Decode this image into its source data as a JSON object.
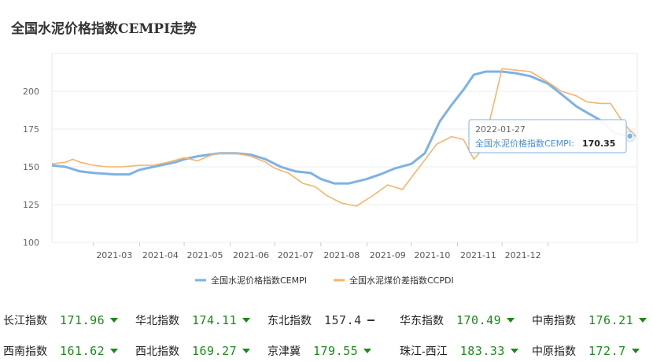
{
  "title": "全国水泥价格指数CEMPI走势",
  "colors": {
    "cempi": "#7eb2e4",
    "ccpdi": "#f5b56c",
    "down": "#1a8a1a",
    "flat": "#333333"
  },
  "chart_data": {
    "type": "line",
    "title": "全国水泥价格指数CEMPI走势",
    "xlabel": "",
    "ylabel": "",
    "ylim": [
      100,
      225
    ],
    "yticks": [
      100,
      125,
      150,
      175,
      200
    ],
    "xticks": [
      "2021-03",
      "2021-04",
      "2021-05",
      "2021-06",
      "2021-07",
      "2021-08",
      "2021-09",
      "2021-10",
      "2021-11",
      "2021-12"
    ],
    "grid": "horizontal",
    "legend": "bottom",
    "series": [
      {
        "name": "全国水泥价格指数CEMPI",
        "color": "#7eb2e4",
        "points": [
          [
            "2021-02-01",
            151
          ],
          [
            "2021-02-10",
            150
          ],
          [
            "2021-02-20",
            147
          ],
          [
            "2021-03-01",
            146
          ],
          [
            "2021-03-15",
            145
          ],
          [
            "2021-03-25",
            145
          ],
          [
            "2021-04-01",
            148
          ],
          [
            "2021-04-15",
            151
          ],
          [
            "2021-04-25",
            153
          ],
          [
            "2021-05-01",
            155
          ],
          [
            "2021-05-10",
            157
          ],
          [
            "2021-05-25",
            159
          ],
          [
            "2021-06-05",
            159
          ],
          [
            "2021-06-15",
            158
          ],
          [
            "2021-06-25",
            155
          ],
          [
            "2021-07-05",
            150
          ],
          [
            "2021-07-15",
            147
          ],
          [
            "2021-07-25",
            146
          ],
          [
            "2021-08-01",
            142
          ],
          [
            "2021-08-10",
            139
          ],
          [
            "2021-08-20",
            139
          ],
          [
            "2021-09-01",
            142
          ],
          [
            "2021-09-10",
            145
          ],
          [
            "2021-09-20",
            149
          ],
          [
            "2021-10-01",
            152
          ],
          [
            "2021-10-10",
            159
          ],
          [
            "2021-10-20",
            180
          ],
          [
            "2021-10-28",
            191
          ],
          [
            "2021-11-05",
            201
          ],
          [
            "2021-11-12",
            211
          ],
          [
            "2021-11-20",
            213
          ],
          [
            "2021-12-01",
            213
          ],
          [
            "2021-12-10",
            212
          ],
          [
            "2021-12-20",
            210
          ],
          [
            "2022-01-01",
            205
          ],
          [
            "2022-01-10",
            198
          ],
          [
            "2022-01-20",
            190
          ],
          [
            "2022-01-27",
            186
          ],
          [
            "2022-02-05",
            181
          ],
          [
            "2022-02-15",
            172
          ],
          [
            "2022-02-25",
            170.35
          ]
        ]
      },
      {
        "name": "全国水泥煤价差指数CCPDI",
        "color": "#f5b56c",
        "points": [
          [
            "2021-02-01",
            152
          ],
          [
            "2021-02-10",
            153
          ],
          [
            "2021-02-15",
            155
          ],
          [
            "2021-02-20",
            153
          ],
          [
            "2021-03-01",
            151
          ],
          [
            "2021-03-10",
            150
          ],
          [
            "2021-03-20",
            150
          ],
          [
            "2021-04-01",
            151
          ],
          [
            "2021-04-10",
            151
          ],
          [
            "2021-04-20",
            153
          ],
          [
            "2021-05-01",
            156
          ],
          [
            "2021-05-10",
            154
          ],
          [
            "2021-05-20",
            158
          ],
          [
            "2021-05-25",
            159
          ],
          [
            "2021-06-05",
            159
          ],
          [
            "2021-06-15",
            157
          ],
          [
            "2021-06-25",
            153
          ],
          [
            "2021-07-01",
            149
          ],
          [
            "2021-07-10",
            146
          ],
          [
            "2021-07-20",
            139
          ],
          [
            "2021-07-28",
            137
          ],
          [
            "2021-08-05",
            131
          ],
          [
            "2021-08-15",
            126
          ],
          [
            "2021-08-25",
            124
          ],
          [
            "2021-09-05",
            131
          ],
          [
            "2021-09-15",
            138
          ],
          [
            "2021-09-25",
            135
          ],
          [
            "2021-10-01",
            143
          ],
          [
            "2021-10-08",
            152
          ],
          [
            "2021-10-18",
            165
          ],
          [
            "2021-10-28",
            170
          ],
          [
            "2021-11-05",
            168
          ],
          [
            "2021-11-12",
            155
          ],
          [
            "2021-11-18",
            162
          ],
          [
            "2021-11-25",
            190
          ],
          [
            "2021-12-01",
            215
          ],
          [
            "2021-12-10",
            214
          ],
          [
            "2021-12-20",
            213
          ],
          [
            "2022-01-01",
            206
          ],
          [
            "2022-01-10",
            200
          ],
          [
            "2022-01-20",
            197
          ],
          [
            "2022-01-27",
            193
          ],
          [
            "2022-02-05",
            192
          ],
          [
            "2022-02-12",
            192
          ],
          [
            "2022-02-18",
            183
          ],
          [
            "2022-02-25",
            174
          ],
          [
            "2022-03-01",
            170
          ]
        ]
      }
    ],
    "tooltip": {
      "date": "2022-01-27",
      "series_label": "全国水泥价格指数CEMPI:",
      "value": "170.35"
    }
  },
  "indices": [
    [
      {
        "name": "长江指数",
        "value": "171.96",
        "trend": "down"
      },
      {
        "name": "华北指数",
        "value": "174.11",
        "trend": "down"
      },
      {
        "name": "东北指数",
        "value": "157.4",
        "trend": "flat"
      },
      {
        "name": "华东指数",
        "value": "170.49",
        "trend": "down"
      },
      {
        "name": "中南指数",
        "value": "176.21",
        "trend": "down"
      }
    ],
    [
      {
        "name": "西南指数",
        "value": "161.62",
        "trend": "down"
      },
      {
        "name": "西北指数",
        "value": "169.27",
        "trend": "down"
      },
      {
        "name": "京津冀",
        "value": "179.55",
        "trend": "down"
      },
      {
        "name": "珠江-西江",
        "value": "183.33",
        "trend": "down"
      },
      {
        "name": "中原指数",
        "value": "172.7",
        "trend": "down"
      }
    ]
  ]
}
